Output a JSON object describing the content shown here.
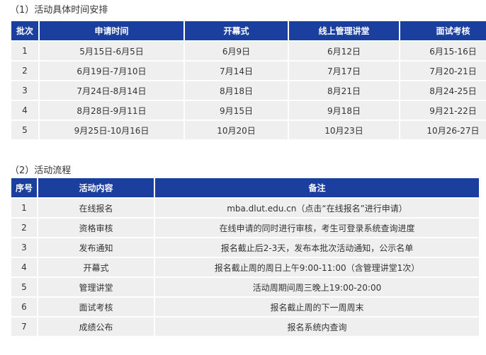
{
  "section1": {
    "title": "（1）活动具体时间安排",
    "headers": [
      "批次",
      "申请时间",
      "开幕式",
      "线上管理讲堂",
      "面试考核"
    ],
    "rows": [
      [
        "1",
        "5月15日-6月5日",
        "6月9日",
        "6月12日",
        "6月15-16日"
      ],
      [
        "2",
        "6月19日-7月10日",
        "7月14日",
        "7月17日",
        "7月20-21日"
      ],
      [
        "3",
        "7月24日-8月14日",
        "8月18日",
        "8月21日",
        "8月24-25日"
      ],
      [
        "4",
        "8月28日-9月11日",
        "9月15日",
        "9月18日",
        "9月21-22日"
      ],
      [
        "5",
        "9月25日-10月16日",
        "10月20日",
        "10月23日",
        "10月26-27日"
      ]
    ]
  },
  "section2": {
    "title": "（2）活动流程",
    "headers": [
      "序号",
      "活动内容",
      "备注"
    ],
    "rows": [
      [
        "1",
        "在线报名",
        "mba.dlut.edu.cn（点击“在线报名”进行申请）"
      ],
      [
        "2",
        "资格审核",
        "在线申请的同时进行审核，考生可登录系统查询进度"
      ],
      [
        "3",
        "发布通知",
        "报名截止后2-3天，发布本批次活动通知，公示名单"
      ],
      [
        "4",
        "开幕式",
        "报名截止周的周日上午9:00-11:00（含管理讲堂1次）"
      ],
      [
        "5",
        "管理讲堂",
        "活动周期间周三晚上19:00-20:00"
      ],
      [
        "6",
        "面试考核",
        "报名截止周的下一周周末"
      ],
      [
        "7",
        "成绩公布",
        "报名系统内查询"
      ]
    ]
  }
}
